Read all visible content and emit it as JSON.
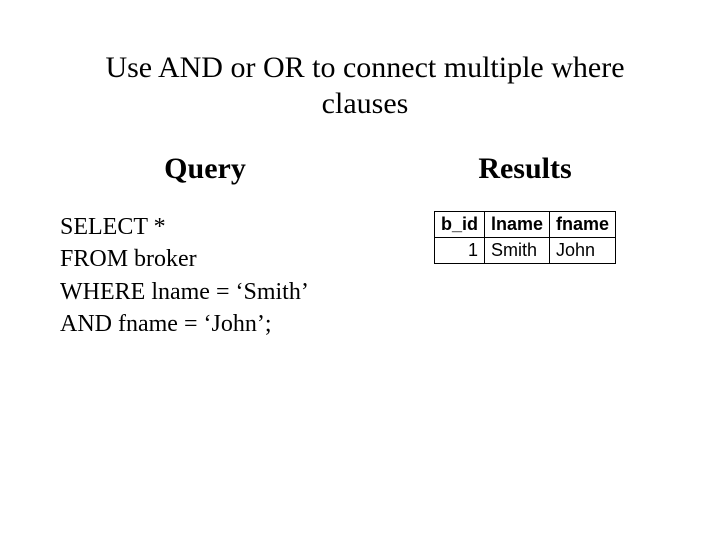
{
  "title_line1": "Use AND or OR  to connect multiple where",
  "title_line2": "clauses",
  "query_heading": "Query",
  "results_heading": "Results",
  "sql": {
    "l1": "SELECT *",
    "l2": "FROM broker",
    "l3": "WHERE lname = ‘Smith’",
    "l4": "AND fname = ‘John’;"
  },
  "table": {
    "headers": [
      "b_id",
      "lname",
      "fname"
    ],
    "rows": [
      [
        "1",
        "Smith",
        "John"
      ]
    ]
  }
}
